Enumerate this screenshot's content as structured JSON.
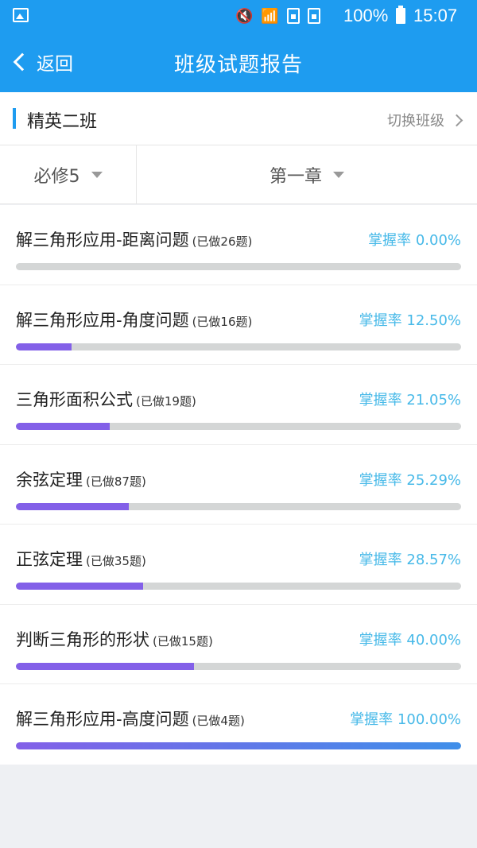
{
  "status": {
    "battery": "100%",
    "time": "15:07",
    "icons": [
      "image-icon",
      "mute-icon",
      "wifi-icon",
      "sim1-icon",
      "sim2-icon",
      "battery-icon"
    ]
  },
  "header": {
    "back_label": "返回",
    "title": "班级试题报告",
    "color": "#1e9cf0"
  },
  "class_bar": {
    "name": "精英二班",
    "switch_label": "切换班级"
  },
  "filters": {
    "book": "必修5",
    "chapter": "第一章"
  },
  "topics": [
    {
      "name": "解三角形应用-距离问题",
      "done": "(已做26题)",
      "rate_label": "掌握率 0.00%",
      "progress": 0.0
    },
    {
      "name": "解三角形应用-角度问题",
      "done": "(已做16题)",
      "rate_label": "掌握率 12.50%",
      "progress": 0.125
    },
    {
      "name": "三角形面积公式",
      "done": "(已做19题)",
      "rate_label": "掌握率 21.05%",
      "progress": 0.2105
    },
    {
      "name": "余弦定理",
      "done": "(已做87题)",
      "rate_label": "掌握率 25.29%",
      "progress": 0.2529
    },
    {
      "name": "正弦定理",
      "done": "(已做35题)",
      "rate_label": "掌握率 28.57%",
      "progress": 0.2857
    },
    {
      "name": "判断三角形的形状",
      "done": "(已做15题)",
      "rate_label": "掌握率 40.00%",
      "progress": 0.4
    },
    {
      "name": "解三角形应用-高度问题",
      "done": "(已做4题)",
      "rate_label": "掌握率 100.00%",
      "progress": 1.0
    }
  ],
  "colors": {
    "accent": "#1e9cf0",
    "rate_text": "#47b9e8",
    "progress_fill": "#8360e8",
    "progress_fill_end": "#3f8fe9",
    "progress_track": "#d4d6d6"
  }
}
